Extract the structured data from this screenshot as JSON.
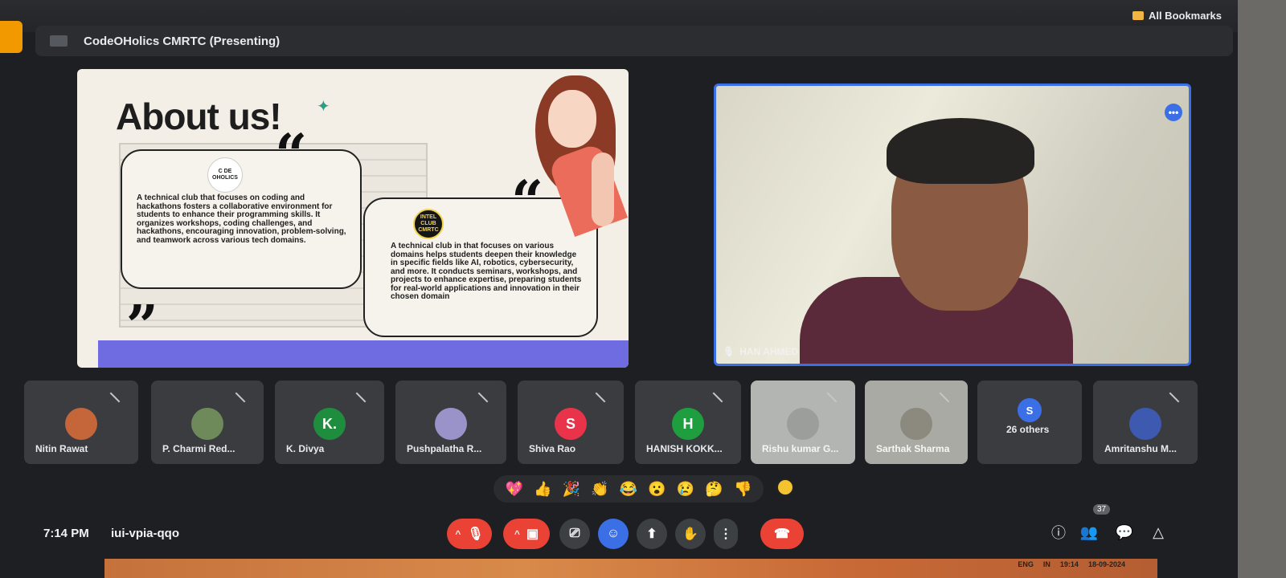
{
  "browser": {
    "bookmarks_label": "All Bookmarks"
  },
  "meeting": {
    "presenting_title": "CodeOHolics CMRTC (Presenting)",
    "time": "7:14 PM",
    "code": "iui-vpia-qqo"
  },
  "slide": {
    "heading": "About us!",
    "logo1_text": "C DE OHOLICS",
    "logo2_text": "INTEL CLUB CMRTC",
    "bubble1_text": "A technical club that focuses on coding and hackathons fosters a collaborative environment for students to enhance their programming skills. It organizes workshops, coding challenges, and hackathons, encouraging innovation, problem-solving, and teamwork across various tech domains.",
    "bubble2_text": "A technical club in that focuses on various domains helps students deepen their knowledge in specific fields like AI, robotics, cybersecurity, and more. It conducts seminars, workshops, and projects to enhance expertise, preparing students for real-world applications and innovation in their chosen domain"
  },
  "main_video": {
    "name": "HAN AHMED",
    "more_label": "•••"
  },
  "participants": [
    {
      "name": "Nitin Rawat",
      "initial": "",
      "color": "#c4663a"
    },
    {
      "name": "P. Charmi Red...",
      "initial": "",
      "color": "#6f8a5a"
    },
    {
      "name": "K. Divya",
      "initial": "K.",
      "color": "#1e8e3e"
    },
    {
      "name": "Pushpalatha R...",
      "initial": "",
      "color": "#9a93c9"
    },
    {
      "name": "Shiva Rao",
      "initial": "S",
      "color": "#e8334a"
    },
    {
      "name": "HANISH KOKK...",
      "initial": "H",
      "color": "#1e9e3e"
    },
    {
      "name": "Rishu kumar G...",
      "initial": "",
      "color": "#9c9e9b"
    },
    {
      "name": "Sarthak Sharma",
      "initial": "",
      "color": "#8c8a7f"
    },
    {
      "name": "26 others",
      "initial": "S",
      "color": "#3b6fe6"
    },
    {
      "name": "Amritanshu M...",
      "initial": "",
      "color": "#3d5ab0"
    }
  ],
  "reactions": [
    "💖",
    "👍",
    "🎉",
    "👏",
    "😂",
    "😮",
    "😢",
    "🤔",
    "👎"
  ],
  "controls": {
    "participant_count": "37"
  },
  "taskbar": {
    "lang": "ENG",
    "region": "IN",
    "clock": "19:14",
    "date": "18-09-2024"
  }
}
